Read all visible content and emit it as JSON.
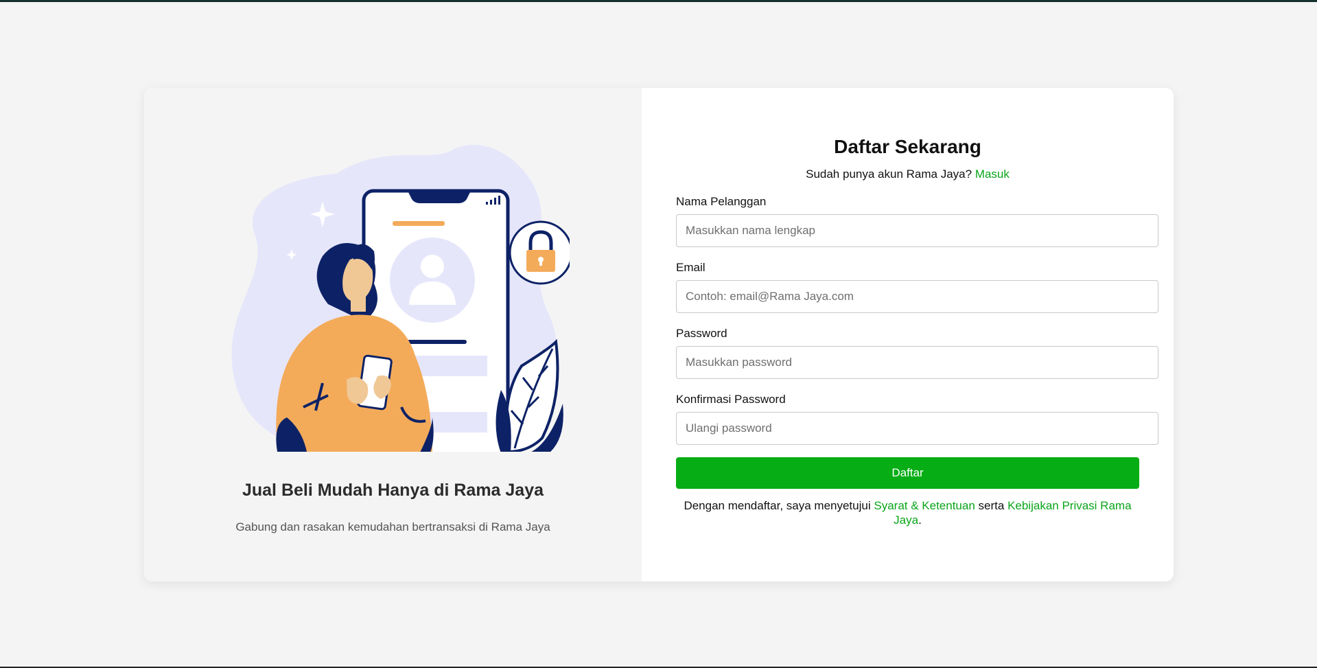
{
  "promo": {
    "title": "Jual Beli Mudah Hanya di Rama Jaya",
    "subtitle": "Gabung dan rasakan kemudahan bertransaksi di Rama Jaya"
  },
  "form": {
    "title": "Daftar Sekarang",
    "login_prompt": "Sudah punya akun Rama Jaya?",
    "login_link": "Masuk",
    "fields": [
      {
        "label": "Nama Pelanggan",
        "placeholder": "Masukkan nama lengkap"
      },
      {
        "label": "Email",
        "placeholder": "Contoh: email@Rama Jaya.com"
      },
      {
        "label": "Password",
        "placeholder": "Masukkan password"
      },
      {
        "label": "Konfirmasi Password",
        "placeholder": "Ulangi password"
      }
    ],
    "submit_label": "Daftar",
    "terms": {
      "prefix": "Dengan mendaftar, saya menyetujui",
      "terms_link": "Syarat & Ketentuan",
      "middle": "serta",
      "privacy_link": "Kebijakan Privasi Rama Jaya",
      "suffix": "."
    }
  },
  "colors": {
    "accent": "#06ad15",
    "link": "#0aa51a",
    "illustration_navy": "#0d2266",
    "illustration_orange": "#f3ab5a",
    "illustration_lavender": "#e6e6fb"
  },
  "icons": [
    "person-illustration",
    "phone-illustration",
    "lock-icon",
    "profile-avatar-icon",
    "signal-icon",
    "sparkle-icon",
    "leaf-icon"
  ]
}
